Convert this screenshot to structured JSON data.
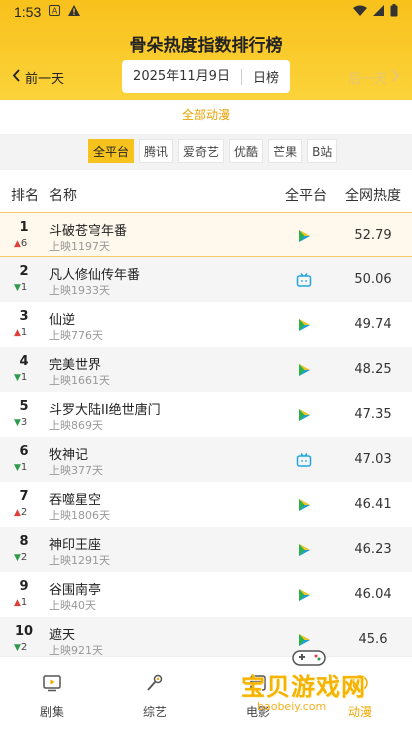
{
  "status_bar": {
    "time": "1:53"
  },
  "header": {
    "title": "骨朵热度指数排行榜",
    "prev_label": "前一天",
    "next_label": "后一天",
    "date": "2025年11月9日",
    "period": "日榜"
  },
  "category": "全部动漫",
  "platforms": [
    "全平台",
    "腾讯",
    "爱奇艺",
    "优酷",
    "芒果",
    "B站"
  ],
  "active_platform": "全平台",
  "table": {
    "headers": {
      "rank": "排名",
      "name": "名称",
      "platform": "全平台",
      "heat": "全网热度"
    },
    "rows": [
      {
        "rank": "1",
        "dir": "up",
        "change": "6",
        "name": "斗破苍穹年番",
        "days": "上映1197天",
        "platform_icon": "play-icon",
        "heat": "52.79"
      },
      {
        "rank": "2",
        "dir": "down",
        "change": "1",
        "name": "凡人修仙传年番",
        "days": "上映1933天",
        "platform_icon": "bilibili-tv-icon",
        "heat": "50.06"
      },
      {
        "rank": "3",
        "dir": "up",
        "change": "1",
        "name": "仙逆",
        "days": "上映776天",
        "platform_icon": "play-icon",
        "heat": "49.74"
      },
      {
        "rank": "4",
        "dir": "down",
        "change": "1",
        "name": "完美世界",
        "days": "上映1661天",
        "platform_icon": "play-icon",
        "heat": "48.25"
      },
      {
        "rank": "5",
        "dir": "down",
        "change": "3",
        "name": "斗罗大陆II绝世唐门",
        "days": "上映869天",
        "platform_icon": "play-icon",
        "heat": "47.35"
      },
      {
        "rank": "6",
        "dir": "down",
        "change": "1",
        "name": "牧神记",
        "days": "上映377天",
        "platform_icon": "bilibili-tv-icon",
        "heat": "47.03"
      },
      {
        "rank": "7",
        "dir": "up",
        "change": "2",
        "name": "吞噬星空",
        "days": "上映1806天",
        "platform_icon": "play-icon",
        "heat": "46.41"
      },
      {
        "rank": "8",
        "dir": "down",
        "change": "2",
        "name": "神印王座",
        "days": "上映1291天",
        "platform_icon": "play-icon",
        "heat": "46.23"
      },
      {
        "rank": "9",
        "dir": "up",
        "change": "1",
        "name": "谷围南亭",
        "days": "上映40天",
        "platform_icon": "play-icon",
        "heat": "46.04"
      },
      {
        "rank": "10",
        "dir": "down",
        "change": "2",
        "name": "遮天",
        "days": "上映921天",
        "platform_icon": "play-icon",
        "heat": "45.6"
      }
    ]
  },
  "tab_bar": {
    "items": [
      {
        "label": "剧集",
        "icon": "tv-icon"
      },
      {
        "label": "综艺",
        "icon": "microphone-icon"
      },
      {
        "label": "电影",
        "icon": "film-icon"
      },
      {
        "label": "动漫",
        "icon": "anime-icon"
      }
    ],
    "active": "动漫"
  },
  "watermark": {
    "text": "宝贝游戏网",
    "url": "baobeiy.com"
  },
  "colors": {
    "accent": "#f6c21e",
    "up": "#e0403b",
    "down": "#2e9b4a",
    "active_tab": "#f0a800"
  }
}
